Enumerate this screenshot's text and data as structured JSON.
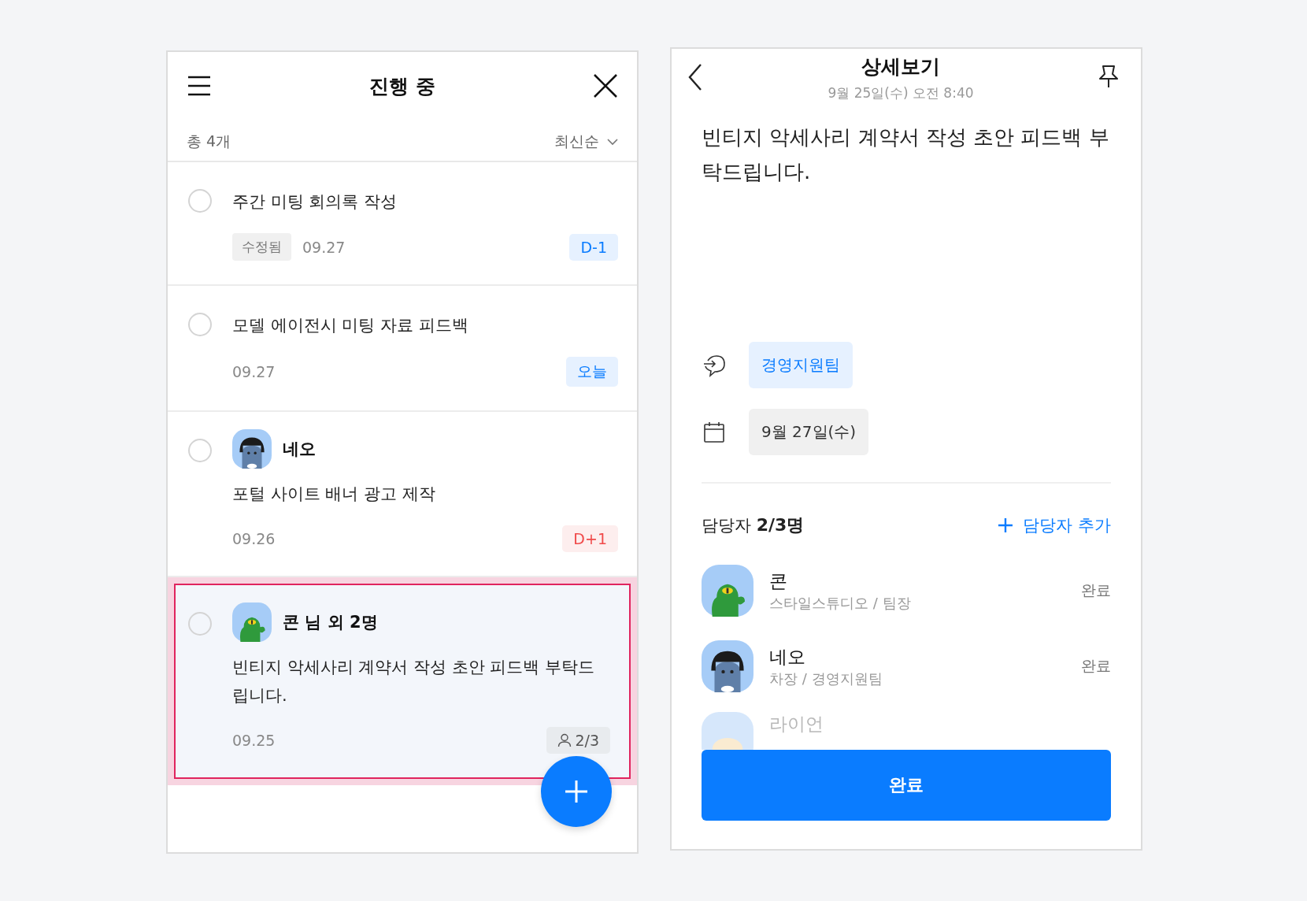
{
  "list_panel": {
    "title": "진행 중",
    "count": "총 4개",
    "sort": "최신순",
    "tasks": [
      {
        "title": "주간 미팅 회의록 작성",
        "tag": "수정됨",
        "date": "09.27",
        "badge": {
          "text": "D-1",
          "kind": "due"
        },
        "checked": false,
        "selected": false
      },
      {
        "title": "모델 에이전시 미팅 자료 피드백",
        "date": "09.27",
        "badge": {
          "text": "오늘",
          "kind": "due"
        },
        "checked": false,
        "selected": false
      },
      {
        "assignee": {
          "name": "네오",
          "kind": "cat"
        },
        "title": "포털 사이트 배너 광고 제작",
        "date": "09.26",
        "badge": {
          "text": "D+1",
          "kind": "overdue"
        },
        "checked": false,
        "selected": false
      },
      {
        "assignee": {
          "name": "콘 님 외 2명",
          "kind": "croc"
        },
        "title": "빈티지 악세사리 계약서 작성 초안 피드백 부탁드립니다.",
        "date": "09.25",
        "badge": {
          "text": "2/3",
          "kind": "assignees"
        },
        "checked": false,
        "selected": true
      }
    ]
  },
  "detail_panel": {
    "title": "상세보기",
    "timestamp": "9월 25일(수) 오전 8:40",
    "body": "빈티지 악세사리 계약서 작성 초안 피드백 부탁드립니다.",
    "team": "경영지원팀",
    "due_date": "9월 27일(수)",
    "assignees_label": "담당자",
    "assignees_count": "2/3명",
    "add_assignee": "담당자 추가",
    "assignees": [
      {
        "name": "콘",
        "role": "스타일스튜디오 / 팀장",
        "status": "완료",
        "kind": "croc"
      },
      {
        "name": "네오",
        "role": "차장 / 경영지원팀",
        "status": "완료",
        "kind": "cat"
      },
      {
        "name": "라이언",
        "kind": "bear"
      }
    ],
    "complete_button": "완료"
  }
}
